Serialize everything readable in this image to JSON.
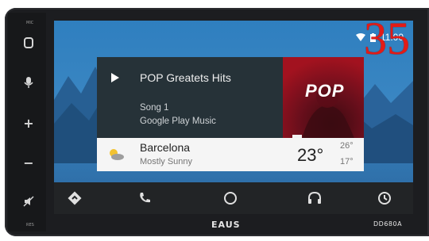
{
  "status_bar": {
    "time": "11:00"
  },
  "media_card": {
    "title": "POP Greatets Hits",
    "track": "Song 1",
    "source": "Google Play Music",
    "album_art_text": "POP"
  },
  "weather_card": {
    "city": "Barcelona",
    "condition": "Mostly Sunny",
    "temperature": "23°",
    "high": "26°",
    "low": "17°"
  },
  "bottom_nav": {
    "items": [
      {
        "icon": "navigation-icon"
      },
      {
        "icon": "phone-icon"
      },
      {
        "icon": "home-icon"
      },
      {
        "icon": "headphones-icon"
      },
      {
        "icon": "recent-icon"
      }
    ]
  },
  "hardware": {
    "side_buttons": [
      "MIC",
      "O",
      "🎤",
      "+",
      "−",
      "RES"
    ],
    "brand": "EAUS",
    "model": "DD680A"
  },
  "overlay_number": "35",
  "colors": {
    "screen_sky": "#2f7fbf",
    "card_dark": "#263238",
    "card_light": "#f5f5f5",
    "album_red": "#a2121f",
    "overlay_red": "#e31b16"
  }
}
